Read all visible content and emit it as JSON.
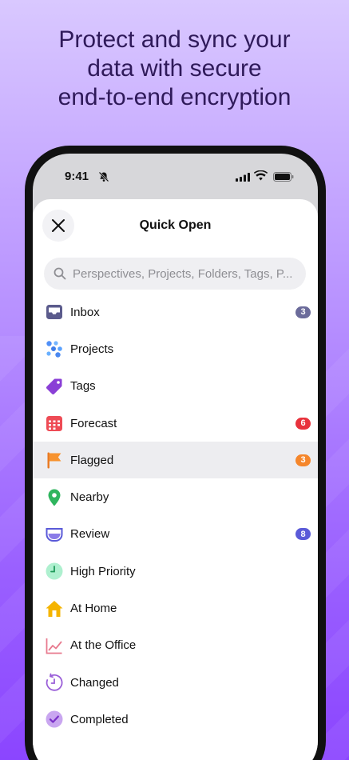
{
  "headline": {
    "line1": "Protect and sync your",
    "line2": "data with secure",
    "line3": "end-to-end encryption"
  },
  "status_bar": {
    "time": "9:41"
  },
  "sheet": {
    "title": "Quick Open",
    "search_placeholder": "Perspectives, Projects, Folders, Tags, P..."
  },
  "items": [
    {
      "label": "Inbox",
      "icon": "inbox-icon",
      "badge": "3",
      "badge_color": "#6b6b9a"
    },
    {
      "label": "Projects",
      "icon": "projects-icon"
    },
    {
      "label": "Tags",
      "icon": "tag-icon"
    },
    {
      "label": "Forecast",
      "icon": "calendar-icon",
      "badge": "6",
      "badge_color": "#e8323c"
    },
    {
      "label": "Flagged",
      "icon": "flag-icon",
      "badge": "3",
      "badge_color": "#f5862b",
      "selected": true
    },
    {
      "label": "Nearby",
      "icon": "location-pin-icon"
    },
    {
      "label": "Review",
      "icon": "review-cup-icon",
      "badge": "8",
      "badge_color": "#5a5ad8"
    },
    {
      "label": "High Priority",
      "icon": "clock-icon"
    },
    {
      "label": "At Home",
      "icon": "house-icon"
    },
    {
      "label": "At the Office",
      "icon": "chart-icon"
    },
    {
      "label": "Changed",
      "icon": "history-icon"
    },
    {
      "label": "Completed",
      "icon": "checkmark-icon"
    }
  ]
}
